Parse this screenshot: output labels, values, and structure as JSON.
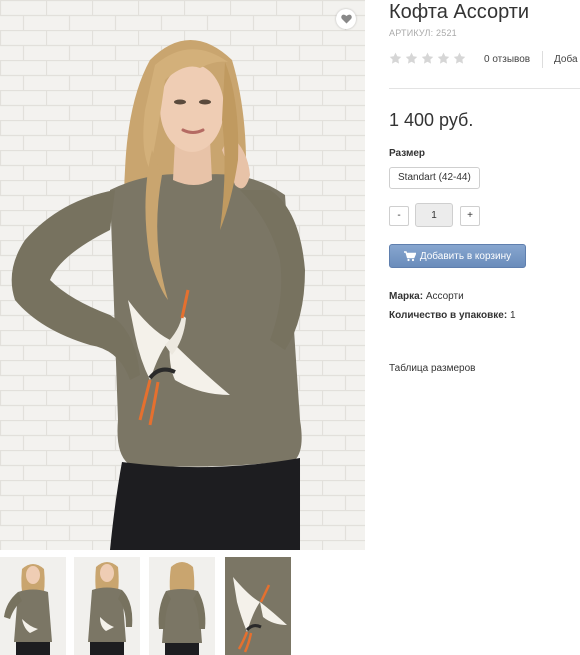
{
  "product": {
    "title": "Кофта Ассорти",
    "sku": "АРТИКУЛ: 2521",
    "rating": 0,
    "reviews_label": "0 отзывов",
    "add_review_label": "Доба",
    "price": "1 400 руб."
  },
  "size": {
    "label": "Размер",
    "selected": "Standart (42-44)"
  },
  "quantity": {
    "minus": "-",
    "value": "1",
    "plus": "+"
  },
  "cart_button": {
    "label": "Добавить в корзину",
    "icon": "cart-icon"
  },
  "properties": [
    {
      "name": "Марка:",
      "value": "Ассорти"
    },
    {
      "name": "Количество в упаковке:",
      "value": "1"
    }
  ],
  "size_table_link": "Таблица размеров",
  "favorite_icon": "heart-icon",
  "gallery": {
    "main_image": "woman-in-olive-sweater-with-stork",
    "thumbnails": [
      "front-view",
      "front-view-alt",
      "back-view",
      "stork-embroidery-closeup"
    ]
  },
  "colors": {
    "sweater": "#7b7665",
    "accent_button": "#7898c6",
    "star_empty": "#d6d6d6"
  }
}
